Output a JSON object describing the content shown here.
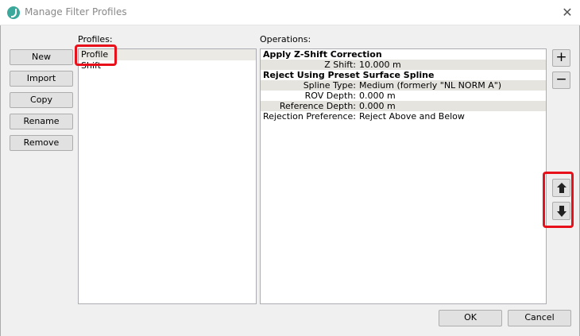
{
  "window": {
    "title": "Manage Filter Profiles",
    "close_icon": "close-icon"
  },
  "left_buttons": [
    "New",
    "Import",
    "Copy",
    "Rename",
    "Remove"
  ],
  "profiles": {
    "label": "Profiles:",
    "items": [
      "Profile",
      "Shift"
    ]
  },
  "operations": {
    "label": "Operations:",
    "rows": [
      {
        "type": "header",
        "text": "Apply Z-Shift Correction"
      },
      {
        "type": "param",
        "key": "Z Shift:",
        "value": "10.000 m"
      },
      {
        "type": "header",
        "text": "Reject Using Preset Surface Spline"
      },
      {
        "type": "param",
        "key": "Spline Type:",
        "value": "Medium (formerly \"NL NORM A\")"
      },
      {
        "type": "param",
        "key": "ROV Depth:",
        "value": "0.000 m"
      },
      {
        "type": "param",
        "key": "Reference Depth:",
        "value": "0.000 m"
      },
      {
        "type": "param",
        "key": "Rejection Preference:",
        "value": "Reject Above and Below"
      }
    ]
  },
  "side_buttons": {
    "add": "+",
    "remove": "−"
  },
  "footer": {
    "ok": "OK",
    "cancel": "Cancel"
  },
  "colors": {
    "highlight": "#e8101a",
    "accent": "#3aa89a"
  }
}
